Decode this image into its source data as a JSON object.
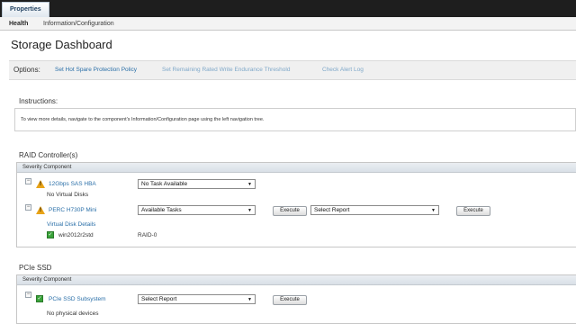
{
  "top_tabs": {
    "properties": "Properties"
  },
  "sub_tabs": {
    "health": "Health",
    "info": "Information/Configuration"
  },
  "page": {
    "title": "Storage Dashboard"
  },
  "options": {
    "label": "Options:",
    "links": [
      "Set Hot Spare Protection Policy",
      "Set Remaining Rated Write Endurance Threshold",
      "Check Alert Log"
    ]
  },
  "instructions": {
    "title": "Instructions:",
    "text": "To view more details, navigate to the component's Information/Configuration page using the left navigation tree."
  },
  "raid": {
    "title": "RAID Controller(s)",
    "header": "Severity Component",
    "controllers": [
      {
        "name": "12Gbps SAS HBA",
        "status": "No Virtual Disks",
        "task": "No Task Available"
      },
      {
        "name": "PERC H730P Mini",
        "task": "Available Tasks",
        "execute": "Execute",
        "report": "Select Report",
        "execute2": "Execute",
        "vd_title": "Virtual Disk Details",
        "vd_name": "win2012r2std",
        "vd_level": "RAID-0"
      }
    ]
  },
  "pcie": {
    "title": "PCIe SSD",
    "header": "Severity Component",
    "name": "PCIe SSD Subsystem",
    "report": "Select Report",
    "execute": "Execute",
    "status": "No physical devices"
  },
  "icons": {
    "expand": "minus",
    "warning": "warning-triangle",
    "ok": "check-square"
  },
  "colors": {
    "link": "#2a6fa8",
    "warning": "#e8a317",
    "ok": "#3aa33a",
    "topbar": "#1e1e1e"
  }
}
